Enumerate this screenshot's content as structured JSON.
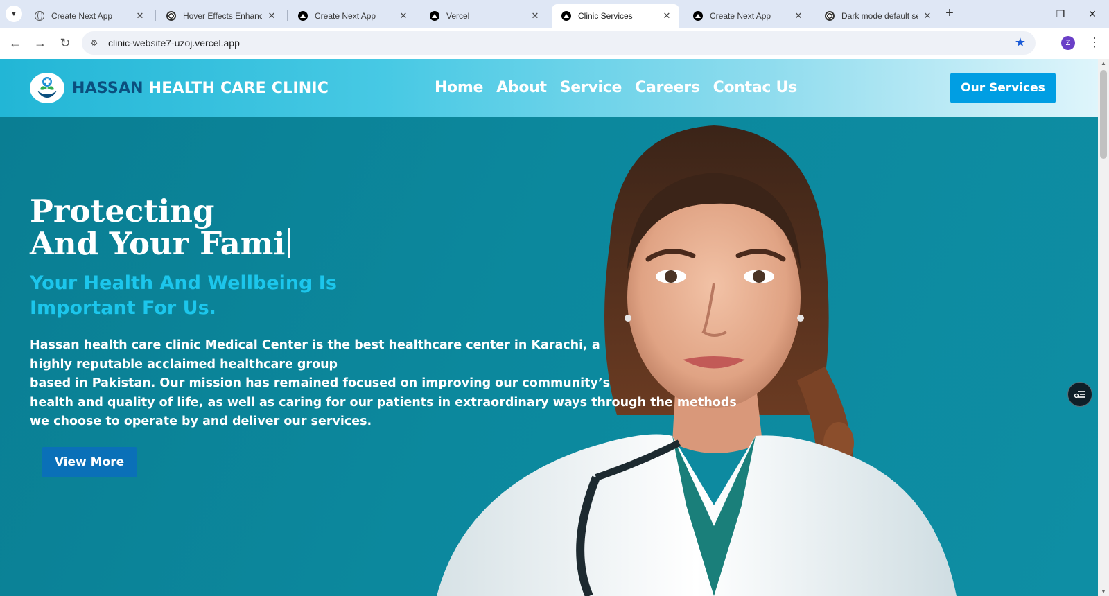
{
  "browser": {
    "tabs": [
      {
        "title": "Create Next App",
        "icon": "globe-icon"
      },
      {
        "title": "Hover Effects Enhancement",
        "icon": "openai-icon"
      },
      {
        "title": "Create Next App",
        "icon": "vercel-icon"
      },
      {
        "title": "Vercel",
        "icon": "vercel-icon"
      },
      {
        "title": "Clinic Services",
        "icon": "vercel-icon"
      },
      {
        "title": "Create Next App",
        "icon": "vercel-icon"
      },
      {
        "title": "Dark mode default settings",
        "icon": "openai-icon"
      }
    ],
    "url": "clinic-website7-uzoj.vercel.app",
    "profile_initial": "Z"
  },
  "header": {
    "brand_part1": "HASSAN",
    "brand_part2": "HEALTH CARE CLINIC",
    "nav": [
      "Home",
      "About",
      "Service",
      "Careers",
      "Contac Us"
    ],
    "cta_label": "Our Services"
  },
  "hero": {
    "title_line1": "Protecting",
    "title_line2": "And Your Fami",
    "subtitle": "Your Health And Wellbeing Is Important For Us.",
    "paragraph_lines": [
      "Hassan health care clinic Medical Center is the best healthcare center in Karachi, a",
      "highly reputable acclaimed healthcare group",
      "based in Pakistan. Our mission has remained focused on improving our community’s",
      "health and quality of life, as well as caring for our patients in extraordinary ways through the methods",
      "we choose to operate by and deliver our services."
    ],
    "button_label": "View More"
  },
  "colors": {
    "header_start": "#22b6d6",
    "hero_bg": "#0c889d",
    "brand_dark": "#0b4f7e",
    "subtitle": "#1cc6ec",
    "cta_bg": "#009ee3",
    "view_more_bg": "#0a70b8"
  }
}
